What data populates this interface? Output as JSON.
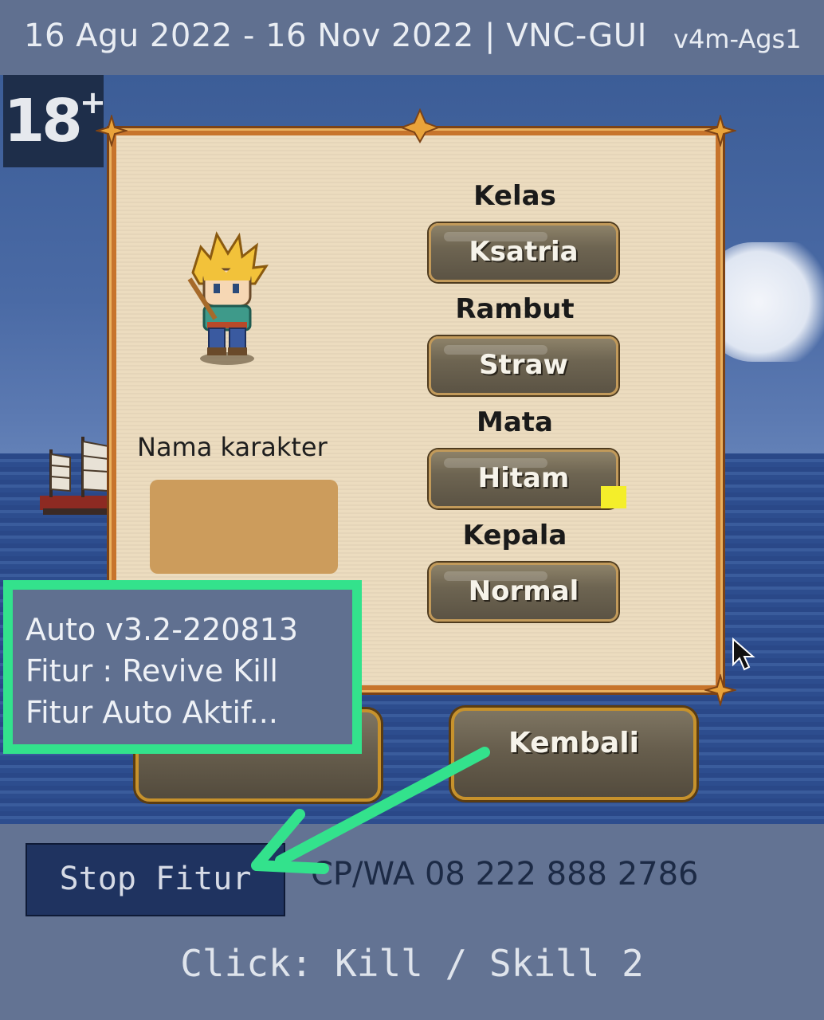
{
  "topbar": {
    "date_range": "16 Agu 2022 - 16 Nov 2022 | VNC-GUI",
    "version": "v4m-Ags1"
  },
  "game": {
    "age_badge": "18",
    "age_badge_suffix": "+",
    "panel": {
      "name_label": "Nama karakter",
      "name_value": "",
      "fields": [
        {
          "label": "Kelas",
          "value": "Ksatria"
        },
        {
          "label": "Rambut",
          "value": "Straw"
        },
        {
          "label": "Mata",
          "value": "Hitam"
        },
        {
          "label": "Kepala",
          "value": "Normal"
        }
      ]
    },
    "back_button": "Kembali",
    "left_button": ""
  },
  "overlay": {
    "line1": "Auto v3.2-220813",
    "line2": "Fitur : Revive Kill",
    "line3": "Fitur Auto Aktif..."
  },
  "bottom": {
    "stop_button": "Stop Fitur",
    "contact": "CP/WA 08 222 888 2786",
    "hint": "Click: Kill / Skill 2"
  },
  "colors": {
    "overlay_border": "#33e28c",
    "arrow": "#33e28c",
    "panel_bg": "#ecdcbf",
    "stop_button_bg": "#1f3360"
  }
}
